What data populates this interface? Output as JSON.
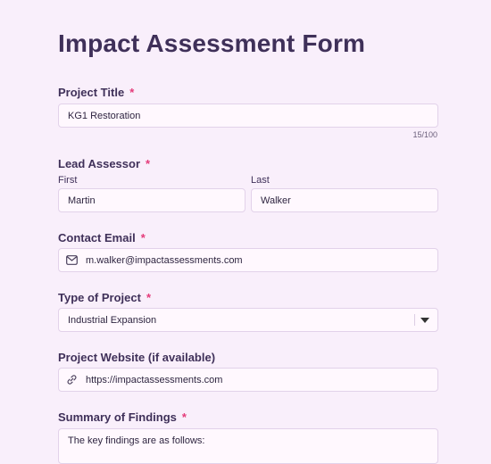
{
  "form": {
    "title": "Impact Assessment Form",
    "required_mark": "*",
    "project_title": {
      "label": "Project Title",
      "value": "KG1 Restoration",
      "counter": "15/100"
    },
    "lead_assessor": {
      "label": "Lead Assessor",
      "first_label": "First",
      "first_value": "Martin",
      "last_label": "Last",
      "last_value": "Walker"
    },
    "contact_email": {
      "label": "Contact Email",
      "value": "m.walker@impactassessments.com",
      "icon": "mail-icon"
    },
    "project_type": {
      "label": "Type of Project",
      "selected": "Industrial Expansion"
    },
    "website": {
      "label": "Project Website (if available)",
      "value": "https://impactassessments.com",
      "icon": "link-icon"
    },
    "summary": {
      "label": "Summary of Findings",
      "value": "The key findings are as follows:"
    }
  },
  "colors": {
    "background": "#f9effb",
    "required": "#e43b7a",
    "label": "#3f3059"
  }
}
